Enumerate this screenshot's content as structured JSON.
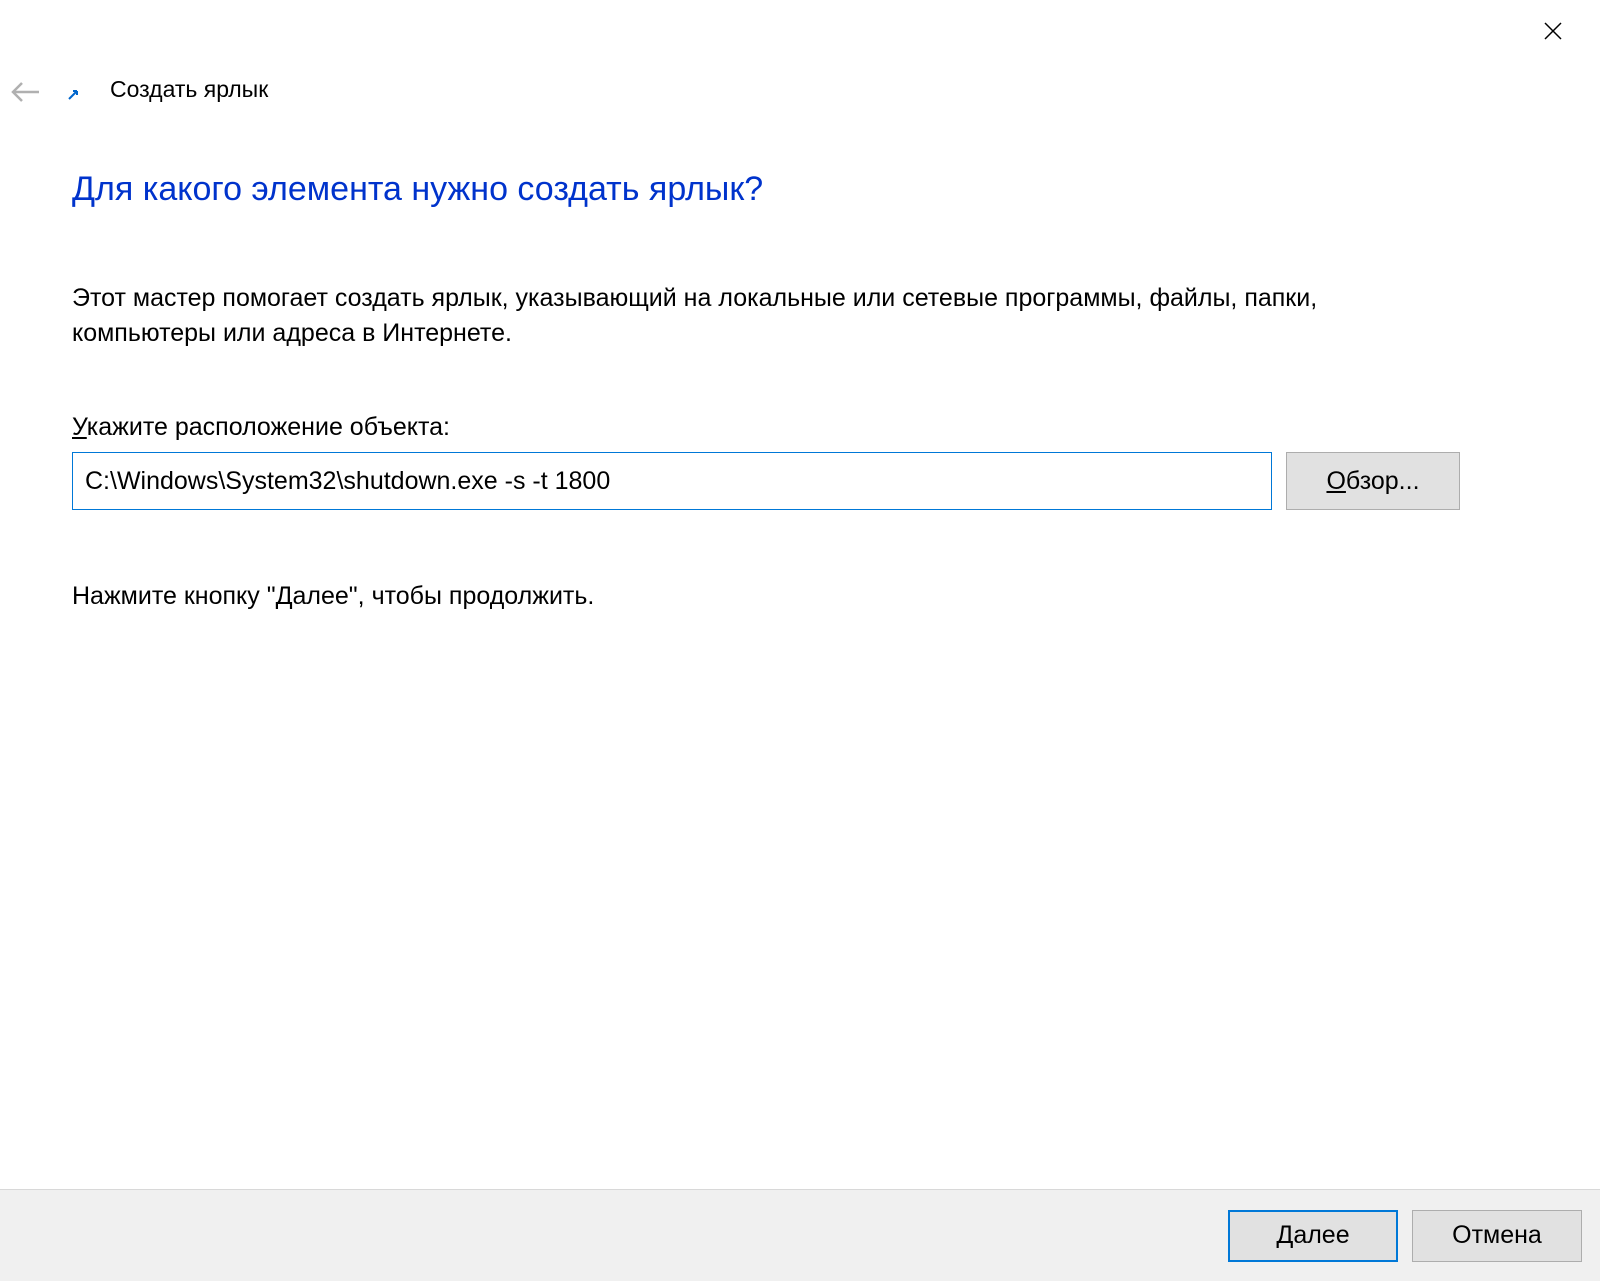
{
  "window": {
    "title": "Создать ярлык"
  },
  "main": {
    "heading": "Для какого элемента нужно создать ярлык?",
    "description": "Этот мастер помогает создать ярлык, указывающий на локальные или сетевые программы, файлы, папки, компьютеры или адреса в Интернете.",
    "field_label_pre": "У",
    "field_label_rest": "кажите расположение объекта:",
    "location_value": "C:\\Windows\\System32\\shutdown.exe -s -t 1800",
    "browse_pre": "О",
    "browse_rest": "бзор...",
    "hint": "Нажмите кнопку \"Далее\", чтобы продолжить."
  },
  "footer": {
    "next_pre": "Д",
    "next_rest": "алее",
    "cancel": "Отмена"
  }
}
